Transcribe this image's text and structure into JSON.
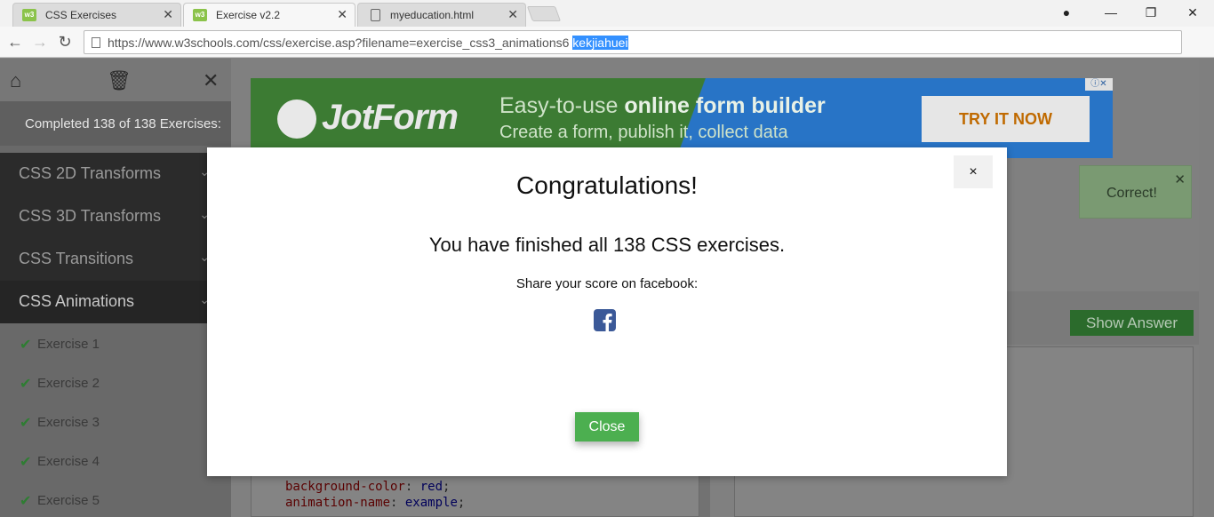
{
  "browser": {
    "tabs": [
      {
        "title": "CSS Exercises",
        "favicon": "w3"
      },
      {
        "title": "Exercise v2.2",
        "favicon": "w3"
      },
      {
        "title": "myeducation.html",
        "favicon": "doc"
      }
    ],
    "tab_favicon_text": "w3",
    "url": "https://www.w3schools.com/css/exercise.asp?filename=exercise_css3_animations6",
    "url_selected": "kekjiahuei"
  },
  "sidebar": {
    "completed": "Completed 138 of 138 Exercises:",
    "categories": [
      {
        "label": "CSS 2D Transforms"
      },
      {
        "label": "CSS 3D Transforms"
      },
      {
        "label": "CSS Transitions"
      },
      {
        "label": "CSS Animations"
      }
    ],
    "exercises": [
      {
        "label": "Exercise 1"
      },
      {
        "label": "Exercise 2"
      },
      {
        "label": "Exercise 3"
      },
      {
        "label": "Exercise 4"
      },
      {
        "label": "Exercise 5"
      }
    ]
  },
  "ad": {
    "brand": "JotForm",
    "line1_prefix": "Easy-to-use ",
    "line1_bold": "online form builder",
    "line2": "Create a form, publish it, collect data",
    "cta": "TRY IT NOW"
  },
  "feedback": {
    "correct": "Correct!"
  },
  "editor": {
    "show_answer": "Show Answer",
    "code": [
      {
        "prop": "background-color",
        "val": "red"
      },
      {
        "prop": "animation-name",
        "val": "example"
      }
    ]
  },
  "modal": {
    "title": "Congratulations!",
    "message": "You have finished all 138 CSS exercises.",
    "share": "Share your score on facebook:",
    "close_label": "Close",
    "close_x": "×"
  },
  "colors": {
    "accent_green": "#4caf50",
    "facebook_blue": "#3b5998"
  }
}
